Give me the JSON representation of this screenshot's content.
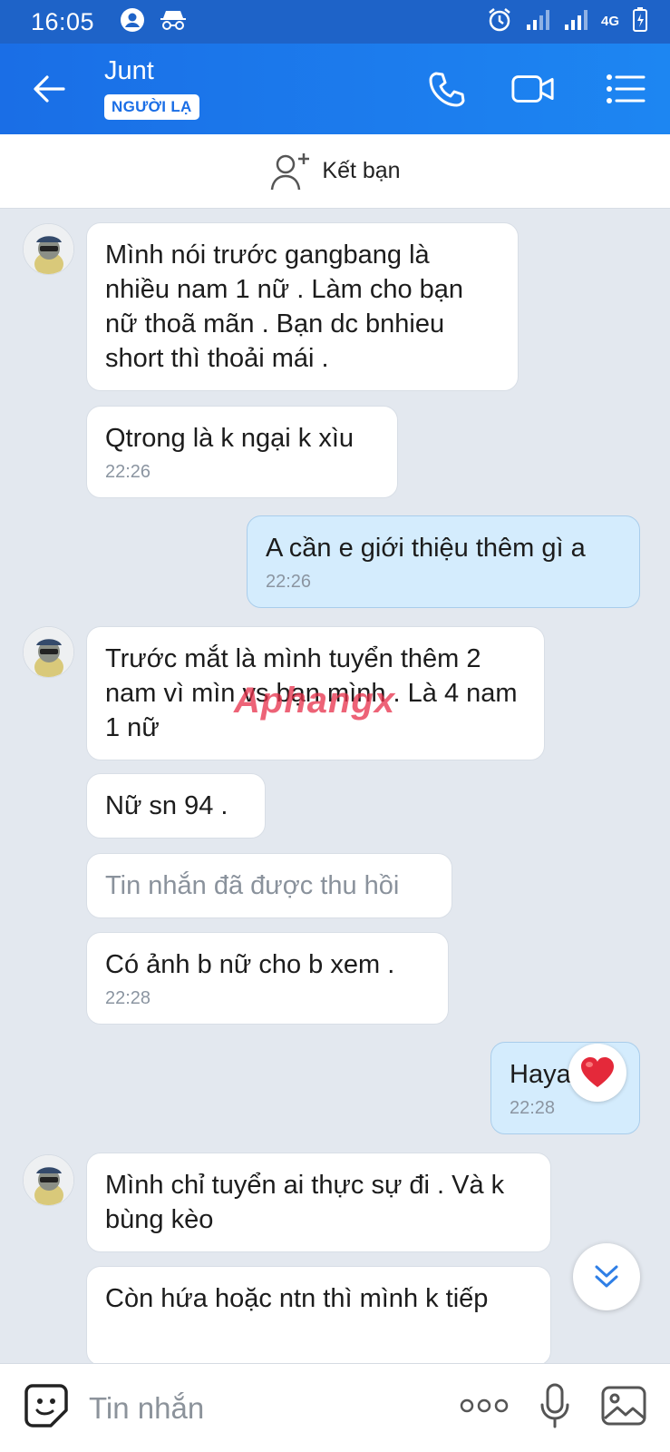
{
  "status": {
    "time": "16:05",
    "network": "4G"
  },
  "header": {
    "contact_name": "Junt",
    "badge": "NGƯỜI LẠ"
  },
  "add_friend": {
    "label": "Kết bạn"
  },
  "messages": [
    {
      "text": "Mình nói trước gangbang là nhiều nam 1 nữ . Làm cho bạn nữ thoã mãn . Bạn dc bnhieu short thì thoải mái ."
    },
    {
      "text": "Qtrong là k ngại k xìu",
      "time": "22:26"
    },
    {
      "text": "A cần e giới thiệu thêm gì a",
      "time": "22:26"
    },
    {
      "text": "Trước mắt là mình tuyển thêm 2 nam vì mìn vs bạn mình . Là 4 nam 1 nữ"
    },
    {
      "text": "Nữ sn 94 ."
    },
    {
      "text": "Tin nhắn đã được thu hồi"
    },
    {
      "text": "Có ảnh b nữ cho b xem .",
      "time": "22:28"
    },
    {
      "text": "Hayaa",
      "time": "22:28"
    },
    {
      "text": "Mình chỉ tuyển ai thực sự đi . Và k bùng kèo"
    },
    {
      "text": "Còn hứa hoặc ntn thì mình k tiếp"
    }
  ],
  "watermark": {
    "part1": "Aphang",
    "part2": "x"
  },
  "input": {
    "placeholder": "Tin nhắn"
  },
  "colors": {
    "header": "#1a6ee6",
    "incoming_bubble": "#ffffff",
    "outgoing_bubble": "#d4ecfd",
    "background": "#e3e8ef"
  }
}
